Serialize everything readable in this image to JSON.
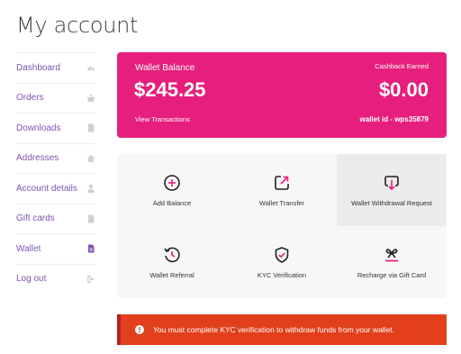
{
  "page": {
    "title": "My account"
  },
  "sidebar": {
    "items": [
      {
        "label": "Dashboard",
        "icon": "dashboard-icon"
      },
      {
        "label": "Orders",
        "icon": "basket-icon"
      },
      {
        "label": "Downloads",
        "icon": "file-icon"
      },
      {
        "label": "Addresses",
        "icon": "home-icon"
      },
      {
        "label": "Account details",
        "icon": "user-icon"
      },
      {
        "label": "Gift cards",
        "icon": "file-icon"
      },
      {
        "label": "Wallet",
        "icon": "file-icon"
      },
      {
        "label": "Log out",
        "icon": "logout-icon"
      }
    ],
    "active_index": 6
  },
  "wallet": {
    "balance_label": "Wallet Balance",
    "balance": "$245.25",
    "view_link": "View Transactions",
    "cashback_label": "Cashback Earned",
    "cashback": "$0.00",
    "wallet_id": "wallet id - wps35879",
    "card_color": "#e61f7c"
  },
  "actions": [
    {
      "label": "Add Balance",
      "icon": "plus-circle-icon"
    },
    {
      "label": "Wallet Transfer",
      "icon": "transfer-icon"
    },
    {
      "label": "Wallet Withdrawal Request",
      "icon": "withdrawal-icon"
    },
    {
      "label": "Wallet Referral",
      "icon": "referral-clock-icon"
    },
    {
      "label": "KYC Verification",
      "icon": "shield-check-icon"
    },
    {
      "label": "Recharge via Gift Card",
      "icon": "gift-card-icon"
    }
  ],
  "notice": {
    "icon": "exclamation-icon",
    "glyph": "!",
    "text": "You must complete KYC verification to withdraw funds from your wallet.",
    "color": "#e2401c"
  },
  "colors": {
    "accent": "#e61f7c",
    "link": "#7f54b3",
    "error": "#e2401c"
  }
}
